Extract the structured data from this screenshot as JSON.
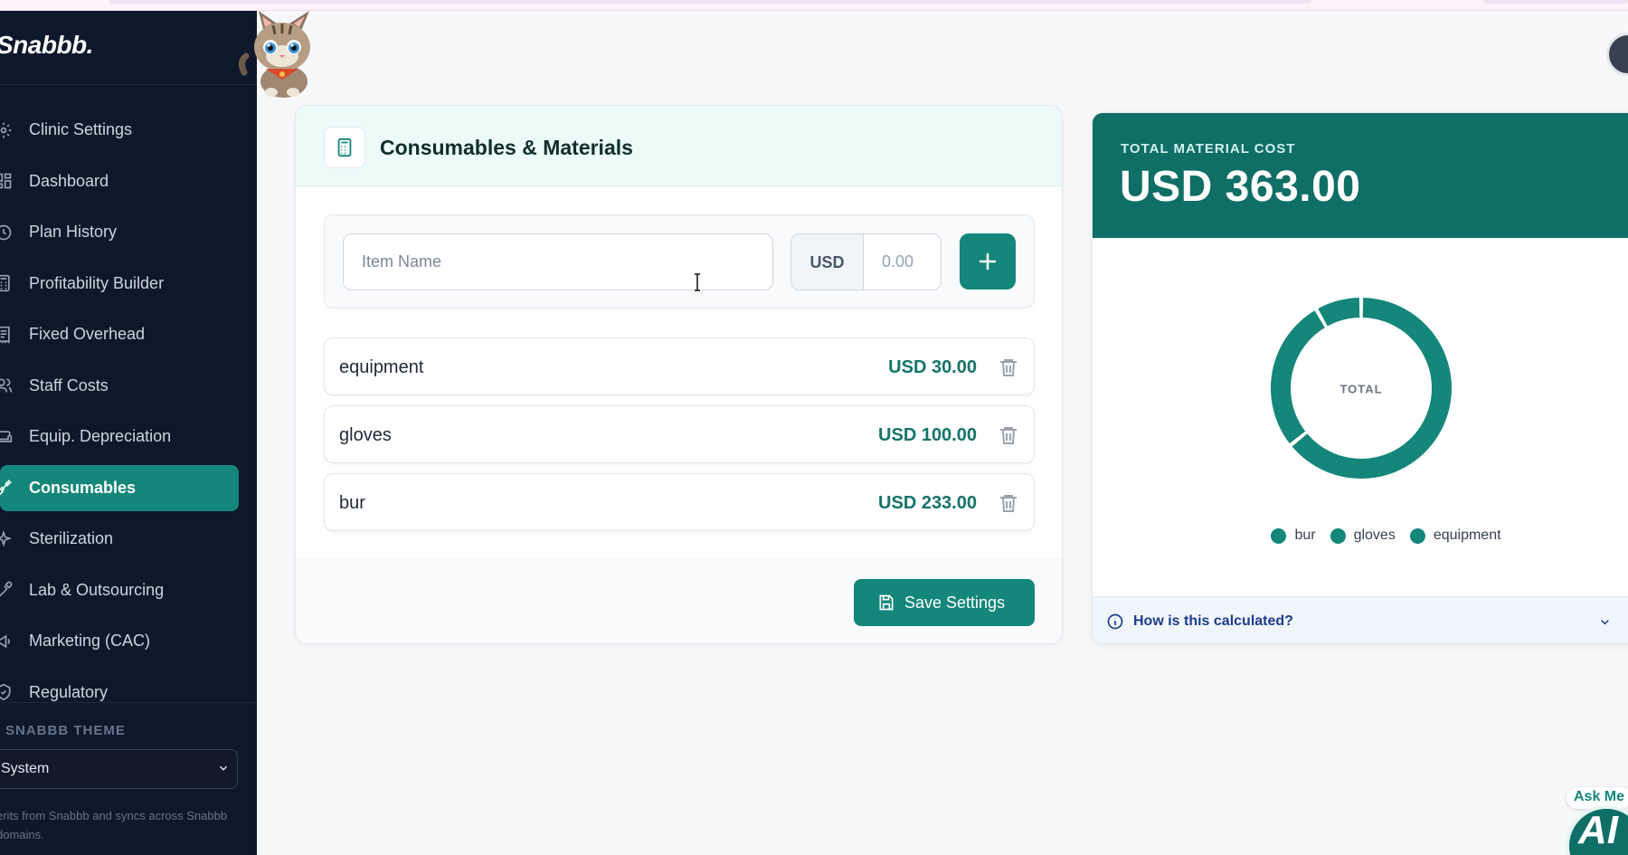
{
  "app": {
    "logo": "Snabbb."
  },
  "sidebar": {
    "items": [
      {
        "label": "Clinic Settings",
        "icon": "gear-icon",
        "active": false
      },
      {
        "label": "Dashboard",
        "icon": "dashboard-icon",
        "active": false
      },
      {
        "label": "Plan History",
        "icon": "history-icon",
        "active": false
      },
      {
        "label": "Profitability Builder",
        "icon": "calculator-icon",
        "active": false
      },
      {
        "label": "Fixed Overhead",
        "icon": "receipt-icon",
        "active": false
      },
      {
        "label": "Staff Costs",
        "icon": "users-icon",
        "active": false
      },
      {
        "label": "Equip. Depreciation",
        "icon": "sofa-icon",
        "active": false
      },
      {
        "label": "Consumables",
        "icon": "syringe-icon",
        "active": true
      },
      {
        "label": "Sterilization",
        "icon": "sparkles-icon",
        "active": false
      },
      {
        "label": "Lab & Outsourcing",
        "icon": "pipette-icon",
        "active": false
      },
      {
        "label": "Marketing (CAC)",
        "icon": "megaphone-icon",
        "active": false
      },
      {
        "label": "Regulatory",
        "icon": "shield-icon",
        "active": false
      }
    ],
    "theme": {
      "title": "SNABBB THEME",
      "selected": "System",
      "note": "erits from Snabbb and syncs across Snabbb domains."
    }
  },
  "consumables": {
    "title": "Consumables & Materials",
    "item_placeholder": "Item Name",
    "currency": "USD",
    "amount_placeholder": "0.00",
    "items": [
      {
        "name": "equipment",
        "price": "USD 30.00"
      },
      {
        "name": "gloves",
        "price": "USD 100.00"
      },
      {
        "name": "bur",
        "price": "USD 233.00"
      }
    ],
    "save_label": "Save Settings"
  },
  "summary": {
    "label": "TOTAL MATERIAL COST",
    "value": "USD 363.00",
    "center_label": "TOTAL",
    "calc_label": "How is this calculated?"
  },
  "chart_data": {
    "type": "pie",
    "categories": [
      "bur",
      "gloves",
      "equipment"
    ],
    "values": [
      233,
      100,
      30
    ],
    "colors": [
      "#14867a",
      "#14867a",
      "#14867a"
    ],
    "legend": "bottom"
  },
  "assistant": {
    "ask_label": "Ask Me",
    "bubble_text": "AI"
  },
  "colors": {
    "accent": "#14867a",
    "sidebar_bg": "#0f172a",
    "summary_header": "#0f6e66"
  }
}
